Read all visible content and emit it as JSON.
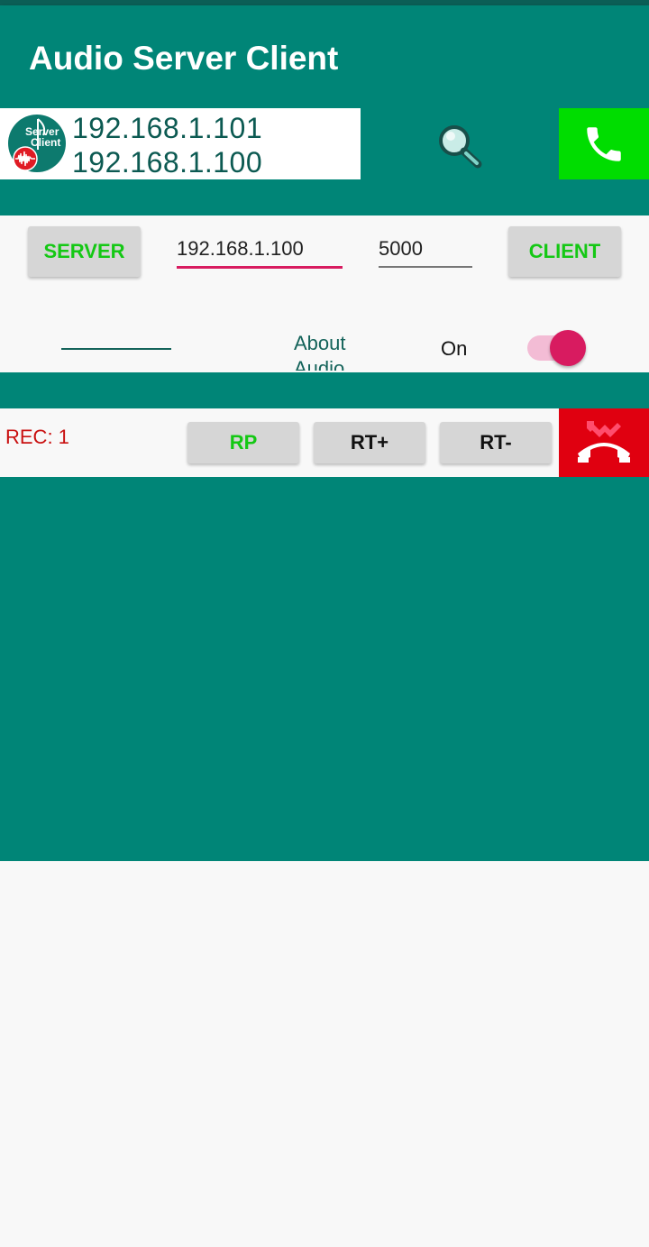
{
  "app": {
    "title": "Audio Server Client"
  },
  "logo": {
    "line1": "Server",
    "line2": "Client"
  },
  "ips": {
    "local": "192.168.1.101",
    "remote": "192.168.1.100"
  },
  "controls": {
    "server_label": "SERVER",
    "ip_value": "192.168.1.100",
    "port_value": "5000",
    "client_label": "CLIENT",
    "blank_field": "__________",
    "about_label": "About Audio",
    "toggle_label": "On",
    "toggle_state": "on"
  },
  "rec": {
    "label": "REC: 1",
    "rp_label": "RP",
    "rt_plus_label": "RT+",
    "rt_minus_label": "RT-"
  },
  "colors": {
    "primary": "#008577",
    "accent": "#D81B60",
    "call_green": "#00DD00",
    "hangup_red": "#E00010"
  }
}
